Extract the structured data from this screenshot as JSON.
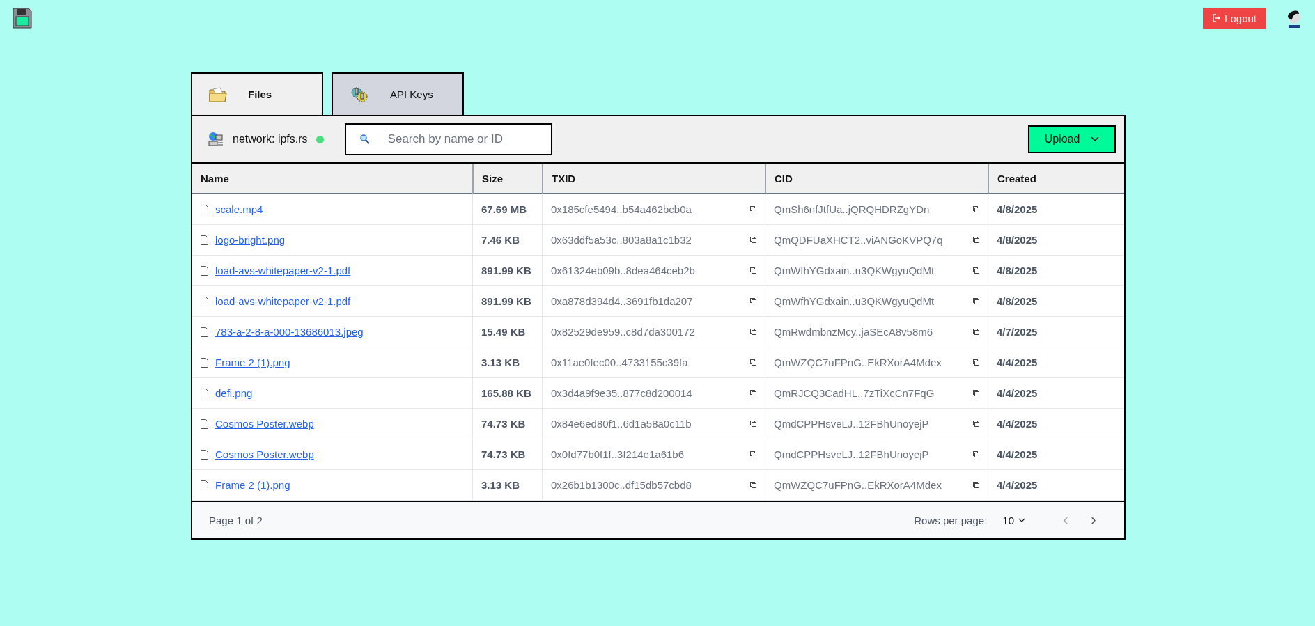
{
  "header": {
    "logout": "Logout"
  },
  "tabs": [
    {
      "label": "Files",
      "selected": true,
      "kind": "folder"
    },
    {
      "label": "API Keys",
      "selected": false,
      "kind": "gears"
    }
  ],
  "toolbar": {
    "network": "network: ipfs.rs",
    "connected": true,
    "search": {
      "placeholder": "Search by name or ID"
    },
    "upload": "Upload"
  },
  "table": {
    "columns": [
      "Name",
      "Size",
      "TXID",
      "CID",
      "Created"
    ],
    "rows": [
      {
        "name": "scale.mp4",
        "size": "67.69 MB",
        "txid": "0x185cfe5494..b54a462bcb0a",
        "cid": "QmSh6nfJtfUa..jQRQHDRZgYDn",
        "created": "4/8/2025"
      },
      {
        "name": "logo-bright.png",
        "size": "7.46 KB",
        "txid": "0x63ddf5a53c..803a8a1c1b32",
        "cid": "QmQDFUaXHCT2..viANGoKVPQ7q",
        "created": "4/8/2025"
      },
      {
        "name": "load-avs-whitepaper-v2-1.pdf",
        "size": "891.99 KB",
        "txid": "0x61324eb09b..8dea464ceb2b",
        "cid": "QmWfhYGdxain..u3QKWgyuQdMt",
        "created": "4/8/2025"
      },
      {
        "name": "load-avs-whitepaper-v2-1.pdf",
        "size": "891.99 KB",
        "txid": "0xa878d394d4..3691fb1da207",
        "cid": "QmWfhYGdxain..u3QKWgyuQdMt",
        "created": "4/8/2025"
      },
      {
        "name": "783-a-2-8-a-000-13686013.jpeg",
        "size": "15.49 KB",
        "txid": "0x82529de959..c8d7da300172",
        "cid": "QmRwdmbnzMcy..jaSEcA8v58m6",
        "created": "4/7/2025"
      },
      {
        "name": "Frame 2 (1).png",
        "size": "3.13 KB",
        "txid": "0x11ae0fec00..4733155c39fa",
        "cid": "QmWZQC7uFPnG..EkRXorA4Mdex",
        "created": "4/4/2025"
      },
      {
        "name": "defi.png",
        "size": "165.88 KB",
        "txid": "0x3d4a9f9e35..877c8d200014",
        "cid": "QmRJCQ3CadHL..7zTiXcCn7FqG",
        "created": "4/4/2025"
      },
      {
        "name": "Cosmos Poster.webp",
        "size": "74.73 KB",
        "txid": "0x84e6ed80f1..6d1a58a0c11b",
        "cid": "QmdCPPHsveLJ..12FBhUnoyejP",
        "created": "4/4/2025"
      },
      {
        "name": "Cosmos Poster.webp",
        "size": "74.73 KB",
        "txid": "0x0fd77b0f1f..3f214e1a61b6",
        "cid": "QmdCPPHsveLJ..12FBhUnoyejP",
        "created": "4/4/2025"
      },
      {
        "name": "Frame 2 (1).png",
        "size": "3.13 KB",
        "txid": "0x26b1b1300c..df15db57cbd8",
        "cid": "QmWZQC7uFPnG..EkRXorA4Mdex",
        "created": "4/4/2025"
      }
    ]
  },
  "footer": {
    "page": "Page 1 of 2",
    "rows_label": "Rows per page:",
    "rows_value": "10",
    "prev": {
      "label": "‹",
      "disabled": true
    },
    "next": {
      "label": "›",
      "disabled": false
    }
  }
}
